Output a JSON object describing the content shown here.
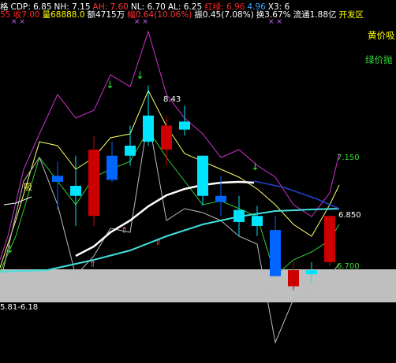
{
  "header": {
    "row1": [
      {
        "text": "格",
        "color": "#ffffff"
      },
      {
        "text": "CDP: 6.85",
        "color": "#ffffff"
      },
      {
        "text": "NH: 7.15",
        "color": "#ffffff"
      },
      {
        "text": "AH: 7.60",
        "color": "#ff3333"
      },
      {
        "text": "NL: 6.70",
        "color": "#ffffff"
      },
      {
        "text": "AL: 6.25",
        "color": "#ffffff"
      },
      {
        "text": "红绿: 6.96",
        "color": "#ff2222"
      },
      {
        "text": "4.96",
        "color": "#3aa0ff"
      },
      {
        "text": "X3: 6",
        "color": "#ffffff"
      }
    ],
    "row2": [
      {
        "text": "55 收7.00",
        "color": "#ff2222"
      },
      {
        "text": "量68888.0",
        "color": "#ffff00"
      },
      {
        "text": "额4715万",
        "color": "#ffffff"
      },
      {
        "text": "幅0.64(10.06%)",
        "color": "#ff3333"
      },
      {
        "text": "振0.45(7.08%)",
        "color": "#ffffff"
      },
      {
        "text": "换3.67%",
        "color": "#ffffff"
      },
      {
        "text": "流通1.88亿",
        "color": "#ffffff"
      },
      {
        "text": "开发区",
        "color": "#ffff00"
      }
    ]
  },
  "side_labels": {
    "yellow_label": "黄价吸",
    "green_label": "绿价抛"
  },
  "price_labels": {
    "high_marker": "8.43",
    "upper_level": "7.150",
    "close_level": "6.850",
    "lower_level": "6.700",
    "band_range": "5.81-6.18",
    "buy_marker": "吸"
  },
  "colors": {
    "background": "#000000",
    "up_candle": "#cc0000",
    "down_candle_cyan": "#00e5ff",
    "down_candle_blue": "#0066ff",
    "ma_white": "#ffffff",
    "ma_cyan": "#40e0e0",
    "magenta_line": "#cc33cc",
    "yellow_line": "#ffff66",
    "green_line": "#33cc33",
    "gray_line": "#bbbbbb",
    "gray_band": "#bfbfbf",
    "blue_line": "#2244cc"
  },
  "chart_data": {
    "type": "candlestick",
    "candles": [
      {
        "open": 7.05,
        "high": 7.12,
        "low": 6.88,
        "close": 7.02
      },
      {
        "open": 7.0,
        "high": 7.15,
        "low": 6.8,
        "close": 6.95
      },
      {
        "open": 6.85,
        "high": 7.25,
        "low": 6.8,
        "close": 7.18
      },
      {
        "open": 7.15,
        "high": 7.22,
        "low": 7.02,
        "close": 7.03
      },
      {
        "open": 7.2,
        "high": 7.3,
        "low": 7.1,
        "close": 7.15
      },
      {
        "open": 7.35,
        "high": 7.5,
        "low": 7.2,
        "close": 7.22
      },
      {
        "open": 7.18,
        "high": 7.35,
        "low": 7.1,
        "close": 7.3
      },
      {
        "open": 7.32,
        "high": 7.4,
        "low": 7.25,
        "close": 7.28
      },
      {
        "open": 7.15,
        "high": 7.05,
        "low": 6.9,
        "close": 6.95
      },
      {
        "open": 6.95,
        "high": 7.05,
        "low": 6.85,
        "close": 6.92
      },
      {
        "open": 6.88,
        "high": 6.95,
        "low": 6.75,
        "close": 6.82
      },
      {
        "open": 6.85,
        "high": 6.9,
        "low": 6.75,
        "close": 6.8
      },
      {
        "open": 6.78,
        "high": 6.85,
        "low": 6.55,
        "close": 6.55
      },
      {
        "open": 6.5,
        "high": 6.62,
        "low": 6.48,
        "close": 6.58
      },
      {
        "open": 6.58,
        "high": 6.62,
        "low": 6.52,
        "close": 6.56
      },
      {
        "open": 6.62,
        "high": 6.85,
        "low": 6.6,
        "close": 6.85
      }
    ]
  }
}
